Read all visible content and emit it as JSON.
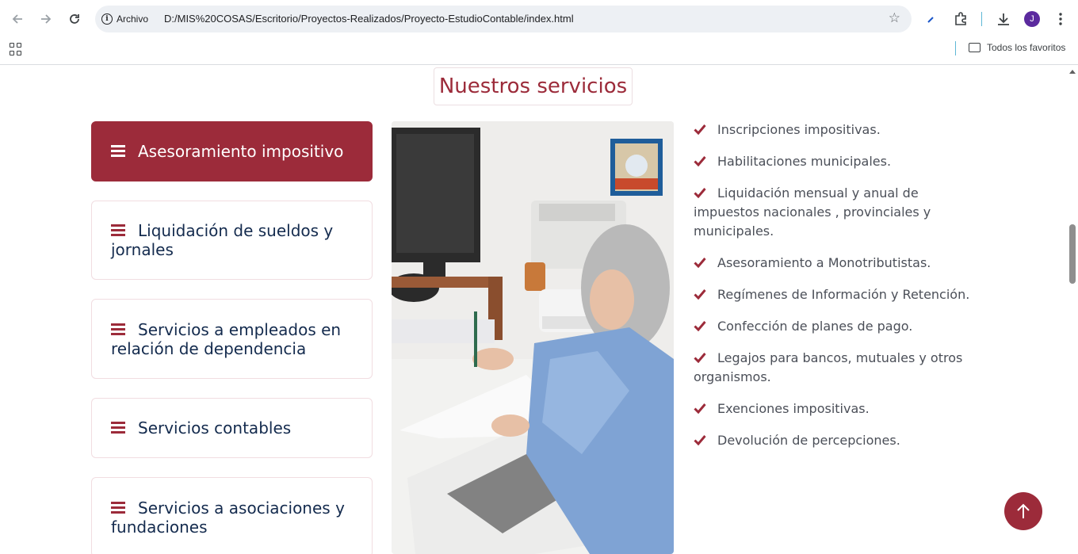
{
  "browser": {
    "address_chip": "Archivo",
    "url": "D:/MIS%20COSAS/Escritorio/Proyectos-Realizados/Proyecto-EstudioContable/index.html",
    "avatar_letter": "J",
    "bookmarks_folder": "Todos los favoritos",
    "icons": [
      "back-icon",
      "forward-icon",
      "reload-icon",
      "star-icon",
      "extensions-icon",
      "download-icon",
      "menu-icon",
      "apps-icon",
      "folder-icon"
    ]
  },
  "section": {
    "title": "Nuestros servicios"
  },
  "cards": [
    {
      "label": "Asesoramiento impositivo",
      "active": true
    },
    {
      "label": "Liquidación de sueldos y jornales",
      "active": false
    },
    {
      "label": "Servicios a empleados en relación de dependencia",
      "active": false
    },
    {
      "label": "Servicios contables",
      "active": false
    },
    {
      "label": "Servicios a asociaciones y fundaciones",
      "active": false
    }
  ],
  "services_list": [
    "Inscripciones impositivas.",
    "Habilitaciones municipales.",
    "Liquidación mensual y anual de impuestos nacionales , provinciales y municipales.",
    "Asesoramiento a Monotributistas.",
    "Regímenes de Información y Retención.",
    "Confección de planes de pago.",
    "Legajos para bancos, mutuales y otros organismos.",
    "Exenciones impositivas.",
    "Devolución de percepciones."
  ],
  "colors": {
    "brand": "#9c2b3a",
    "card_text": "#142b4e",
    "list_text": "#4b4f58"
  }
}
